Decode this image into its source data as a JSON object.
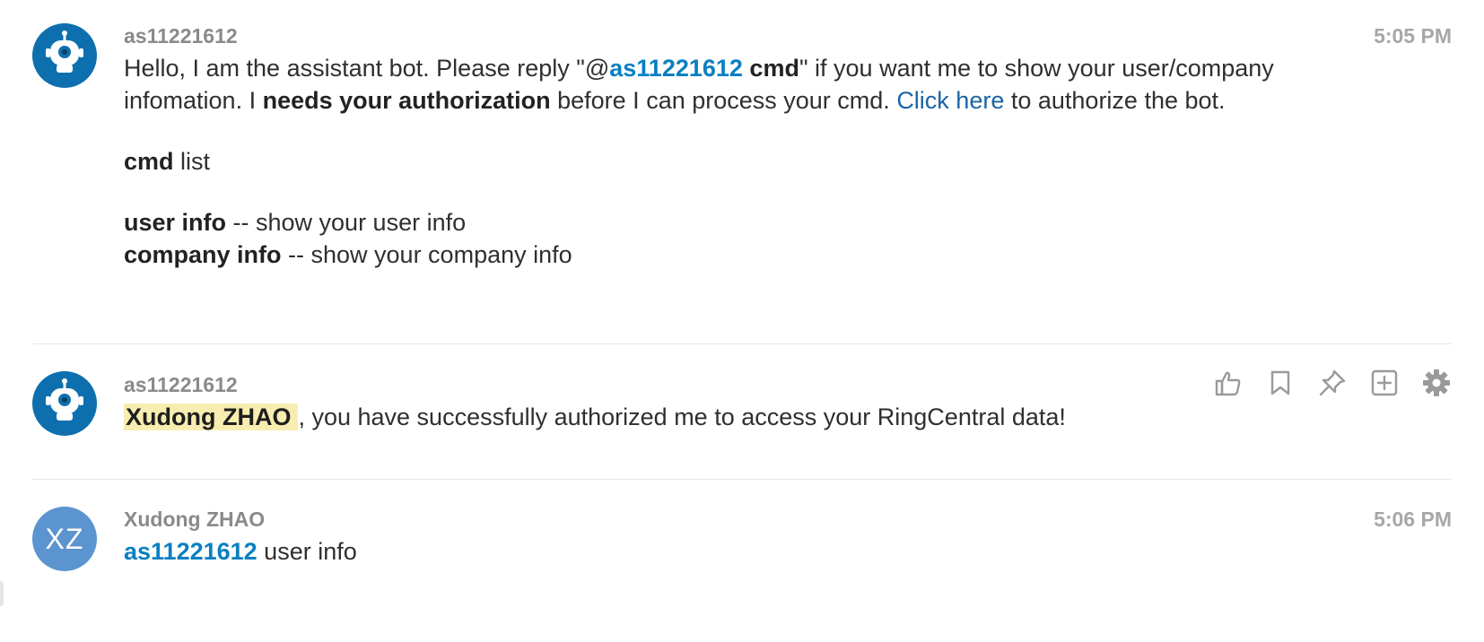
{
  "messages": [
    {
      "sender": "as11221612",
      "time": "5:05 PM",
      "avatar_icon": "robot-icon",
      "line1_pre": "Hello, I am the assistant bot. Please reply \"@",
      "line1_mention": "as11221612",
      "line1_bold": " cmd",
      "line1_post": "\" if you want me to show your user/company infomation. I ",
      "line1_bold2": "needs your authorization",
      "line1_post2": " before I can process your cmd. ",
      "link_text": "Click here",
      "line1_end": " to authorize the bot.",
      "cmd_bold": "cmd",
      "cmd_rest": " list",
      "items": [
        {
          "cmd": "user info",
          "desc": " -- show your user info"
        },
        {
          "cmd": "company info",
          "desc": " -- show your company info"
        }
      ]
    },
    {
      "sender": "as11221612",
      "avatar_icon": "robot-icon",
      "highlight_name": "Xudong ZHAO",
      "text": ", you have successfully authorized me to access your RingCentral data!",
      "actions": [
        "like-icon",
        "bookmark-icon",
        "pin-icon",
        "add-to-icon",
        "settings-icon"
      ]
    },
    {
      "sender": "Xudong ZHAO",
      "time": "5:06 PM",
      "avatar_initials": "XZ",
      "mention": "as11221612",
      "text": " user info"
    }
  ],
  "colors": {
    "mention": "#0a7fc2",
    "link": "#1a64a6",
    "bot_avatar": "#0e6fae",
    "user_avatar": "#5c94cf",
    "highlight": "#f8edb0"
  }
}
